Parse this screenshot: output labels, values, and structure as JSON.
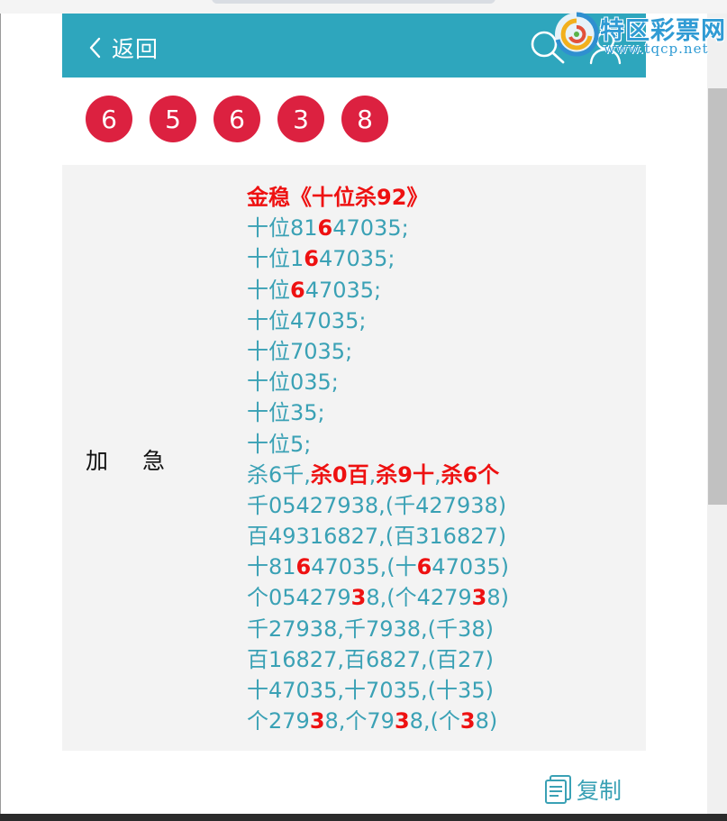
{
  "header": {
    "back_label": "返回",
    "bg_color": "#2ea6bd"
  },
  "logo": {
    "name": "特区彩票网",
    "url": "www.tqcp.net"
  },
  "balls": [
    "6",
    "5",
    "6",
    "3",
    "8"
  ],
  "ball_color": "#dc2140",
  "side_label": [
    "加",
    "急"
  ],
  "title": "金稳《十位杀92》",
  "lines": [
    [
      {
        "t": "十位81"
      },
      {
        "t": "6",
        "hl": true
      },
      {
        "t": "47035;"
      }
    ],
    [
      {
        "t": "十位1"
      },
      {
        "t": "6",
        "hl": true
      },
      {
        "t": "47035;"
      }
    ],
    [
      {
        "t": "十位"
      },
      {
        "t": "6",
        "hl": true
      },
      {
        "t": "47035;"
      }
    ],
    [
      {
        "t": "十位47035;"
      }
    ],
    [
      {
        "t": "十位7035;"
      }
    ],
    [
      {
        "t": "十位035;"
      }
    ],
    [
      {
        "t": "十位35;"
      }
    ],
    [
      {
        "t": "十位5;"
      }
    ],
    [
      {
        "t": "杀6千,"
      },
      {
        "t": "杀0百",
        "hl": true
      },
      {
        "t": ","
      },
      {
        "t": "杀9十",
        "hl": true
      },
      {
        "t": ","
      },
      {
        "t": "杀6个",
        "hl": true
      }
    ],
    [
      {
        "t": "千05427938,(千427938)"
      }
    ],
    [
      {
        "t": "百49316827,(百316827)"
      }
    ],
    [
      {
        "t": "十81"
      },
      {
        "t": "6",
        "hl": true
      },
      {
        "t": "47035,(十"
      },
      {
        "t": "6",
        "hl": true
      },
      {
        "t": "47035)"
      }
    ],
    [
      {
        "t": "个054279"
      },
      {
        "t": "3",
        "hl": true
      },
      {
        "t": "8,(个4279"
      },
      {
        "t": "3",
        "hl": true
      },
      {
        "t": "8)"
      }
    ],
    [
      {
        "t": "千27938,千7938,(千38)"
      }
    ],
    [
      {
        "t": "百16827,百6827,(百27)"
      }
    ],
    [
      {
        "t": "十47035,十7035,(十35)"
      }
    ],
    [
      {
        "t": "个279"
      },
      {
        "t": "3",
        "hl": true
      },
      {
        "t": "8,个79"
      },
      {
        "t": "3",
        "hl": true
      },
      {
        "t": "8,(个"
      },
      {
        "t": "3",
        "hl": true
      },
      {
        "t": "8)"
      }
    ]
  ],
  "copy_label": "复制",
  "colors": {
    "text": "#3aa1b5",
    "highlight": "#ee1111",
    "panel": "#f3f3f3"
  }
}
